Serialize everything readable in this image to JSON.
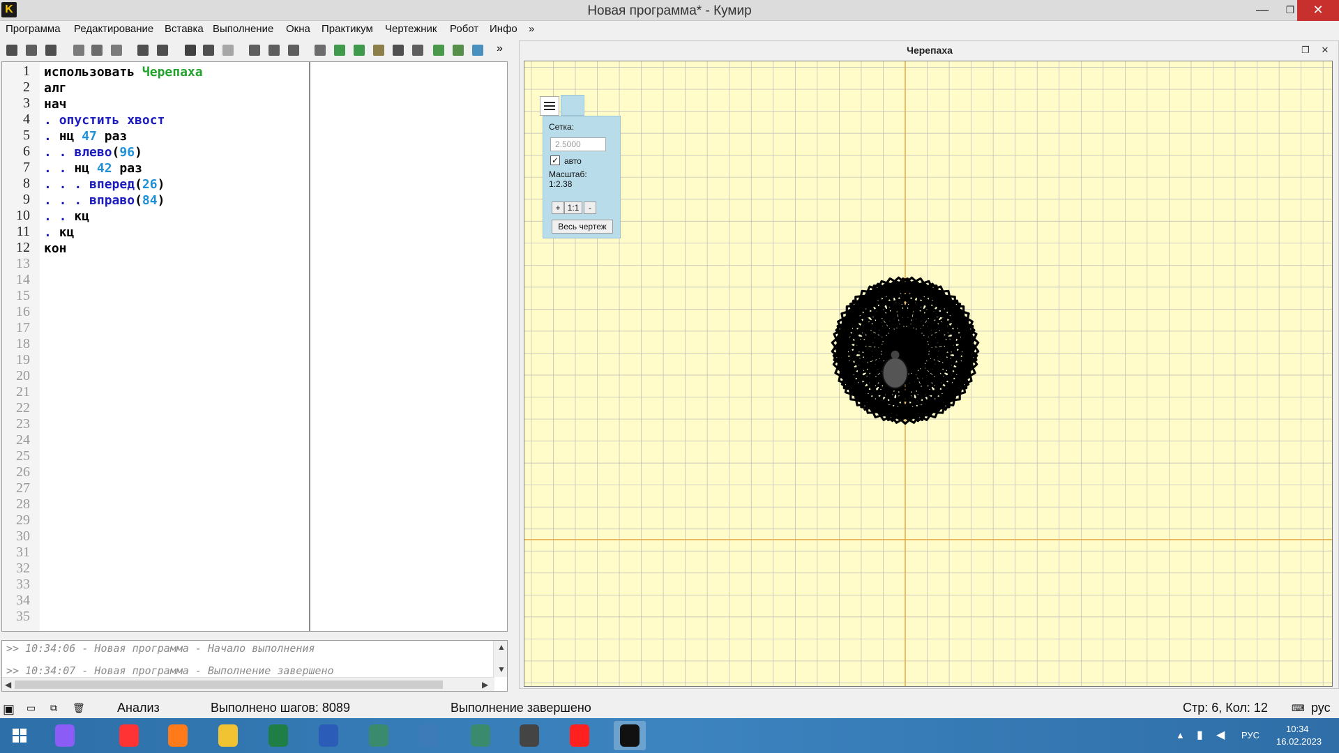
{
  "window": {
    "title": "Новая программа* - Кумир",
    "app_icon_letter": "K",
    "minimize": "—",
    "maximize": "❐",
    "close": "✕"
  },
  "menu": {
    "items": [
      "Программа",
      "Редактирование",
      "Вставка",
      "Выполнение",
      "Окна",
      "Практикум",
      "Чертежник",
      "Робот",
      "Инфо",
      "»"
    ]
  },
  "toolbar": {
    "icons": [
      "new-file-icon",
      "open-icon",
      "save-icon",
      "cut-icon",
      "copy-icon",
      "paste-icon",
      "undo-icon",
      "redo-icon",
      "run-icon",
      "run-step-icon",
      "stop-icon",
      "step-over-icon",
      "step-into-icon",
      "step-out-icon",
      "vars-icon",
      "drawer-icon",
      "robot-icon",
      "turtle-actor-icon",
      "grid-icon",
      "dialog-icon",
      "turtle-icon",
      "robot2-icon",
      "water-icon"
    ],
    "more": "»"
  },
  "editor": {
    "line_numbers": [
      "1",
      "2",
      "3",
      "4",
      "5",
      "6",
      "7",
      "8",
      "9",
      "10",
      "11",
      "12",
      "13",
      "14",
      "15",
      "16",
      "17",
      "18",
      "19",
      "20",
      "21",
      "22",
      "23",
      "24",
      "25",
      "26",
      "27",
      "28",
      "29",
      "30",
      "31",
      "32",
      "33",
      "34",
      "35"
    ],
    "lines": [
      {
        "dots": "",
        "parts": [
          {
            "t": "использовать ",
            "c": "kw"
          },
          {
            "t": "Черепаха",
            "c": "mod"
          }
        ]
      },
      {
        "dots": "",
        "parts": [
          {
            "t": "алг",
            "c": "kw"
          }
        ]
      },
      {
        "dots": "",
        "parts": [
          {
            "t": "нач",
            "c": "kw"
          }
        ]
      },
      {
        "dots": ". ",
        "parts": [
          {
            "t": "опустить хвост",
            "c": "cmd"
          }
        ]
      },
      {
        "dots": ". ",
        "parts": [
          {
            "t": "нц ",
            "c": "kw"
          },
          {
            "t": "47",
            "c": "num"
          },
          {
            "t": " раз",
            "c": "kw"
          }
        ]
      },
      {
        "dots": ". . ",
        "parts": [
          {
            "t": "влево",
            "c": "cmd"
          },
          {
            "t": "(",
            "c": "kw"
          },
          {
            "t": "96",
            "c": "num"
          },
          {
            "t": ")",
            "c": "kw"
          }
        ]
      },
      {
        "dots": ". . ",
        "parts": [
          {
            "t": "нц ",
            "c": "kw"
          },
          {
            "t": "42",
            "c": "num"
          },
          {
            "t": " раз",
            "c": "kw"
          }
        ]
      },
      {
        "dots": ". . . ",
        "parts": [
          {
            "t": "вперед",
            "c": "cmd"
          },
          {
            "t": "(",
            "c": "kw"
          },
          {
            "t": "26",
            "c": "num"
          },
          {
            "t": ")",
            "c": "kw"
          }
        ]
      },
      {
        "dots": ". . . ",
        "parts": [
          {
            "t": "вправо",
            "c": "cmd"
          },
          {
            "t": "(",
            "c": "kw"
          },
          {
            "t": "84",
            "c": "num"
          },
          {
            "t": ")",
            "c": "kw"
          }
        ]
      },
      {
        "dots": ". . ",
        "parts": [
          {
            "t": "кц",
            "c": "kw"
          }
        ]
      },
      {
        "dots": ". ",
        "parts": [
          {
            "t": "кц",
            "c": "kw"
          }
        ]
      },
      {
        "dots": "",
        "parts": [
          {
            "t": "кон",
            "c": "kw"
          }
        ]
      }
    ]
  },
  "console": {
    "lines": [
      ">> 10:34:06 - Новая программа - Начало выполнения",
      ">> 10:34:07 - Новая программа - Выполнение завершено"
    ]
  },
  "turtle_panel": {
    "title": "Черепаха",
    "grid_label": "Сетка:",
    "grid_value": "2.5000",
    "auto_label": "авто",
    "auto_checked": true,
    "scale_label": "Масштаб:",
    "scale_value": "1:2.38",
    "zoom_in": "+",
    "zoom_reset": "1:1",
    "zoom_out": "-",
    "fit_button": "Весь чертеж",
    "drawing": {
      "outer_repeats": 47,
      "inner_repeats": 42,
      "left_turn": 96,
      "forward": 26,
      "right_turn": 84
    },
    "colors": {
      "background": "#fffcc9",
      "grid": "#b8b8b8",
      "axis": "#e6a43a",
      "stroke": "#000000"
    }
  },
  "status": {
    "mode": "Анализ",
    "steps": "Выполнено шагов: 8089",
    "state": "Выполнение завершено",
    "cursor": "Стр: 6, Кол: 12",
    "lang": "рус"
  },
  "taskbar": {
    "apps": [
      "start-icon",
      "alice-icon",
      "yandex-browser-icon",
      "firefox-icon",
      "explorer-icon",
      "excel-icon",
      "word-icon",
      "window-icon",
      "python-icon",
      "app-icon",
      "scanner-icon",
      "yandex-icon",
      "kumir-icon"
    ],
    "tray_lang": "РУС",
    "time": "10:34",
    "date": "16.02.2023"
  }
}
